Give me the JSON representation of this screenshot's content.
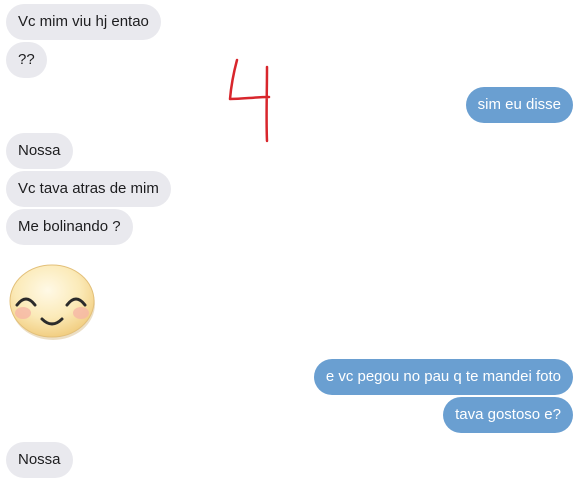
{
  "messages": [
    {
      "side": "in",
      "text": "Vc mim viu hj entao"
    },
    {
      "side": "in",
      "text": "??"
    },
    {
      "side": "out",
      "text": "sim eu disse"
    },
    {
      "side": "in",
      "text": "Nossa"
    },
    {
      "side": "in",
      "text": "Vc tava atras de mim"
    },
    {
      "side": "in",
      "text": "Me bolinando ?"
    },
    {
      "side": "in",
      "sticker": "smiling-face-sticker"
    },
    {
      "side": "out",
      "text": "e vc pegou no pau q te mandei foto"
    },
    {
      "side": "out",
      "text": "tava gostoso e?"
    },
    {
      "side": "in",
      "text": "Nossa"
    }
  ],
  "colors": {
    "incoming_bubble": "#e9e9ee",
    "outgoing_bubble": "#6a9fd1",
    "annotation_ink": "#d8262c"
  },
  "annotation": "4"
}
